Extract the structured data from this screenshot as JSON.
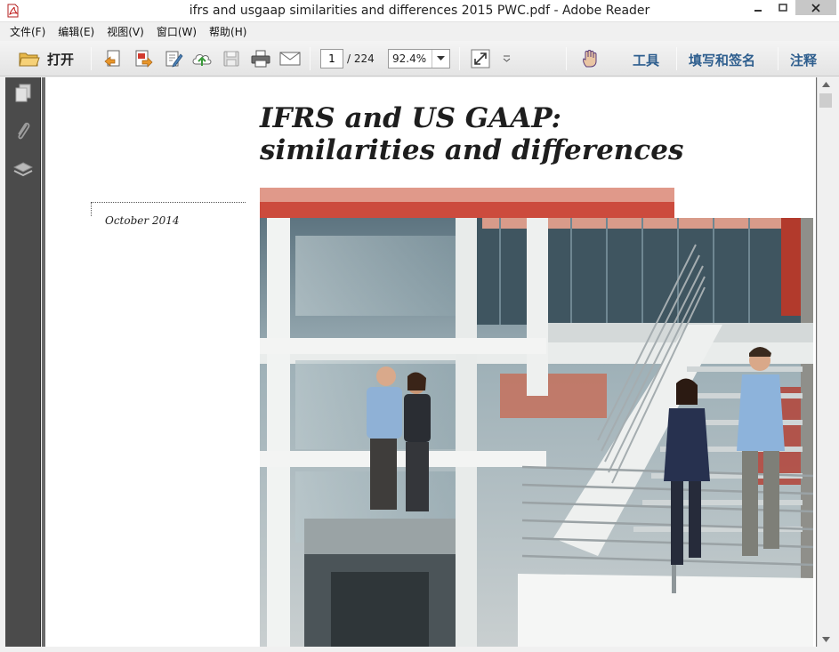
{
  "window": {
    "title": "ifrs and usgaap similarities and differences 2015 PWC.pdf - Adobe Reader",
    "app_icon": "adobe-reader-icon"
  },
  "menubar": {
    "items": [
      "文件(F)",
      "编辑(E)",
      "视图(V)",
      "窗口(W)",
      "帮助(H)"
    ]
  },
  "toolbar": {
    "open_label": "打开",
    "page_current": "1",
    "page_total": "/ 224",
    "zoom": "92.4%",
    "right_links": [
      "工具",
      "填写和签名",
      "注释"
    ]
  },
  "document": {
    "title_line1": "IFRS and US GAAP:",
    "title_line2": "similarities and differences",
    "date": "October 2014",
    "accent_light": "#e0998a",
    "accent_dark": "#cc4b3d"
  }
}
